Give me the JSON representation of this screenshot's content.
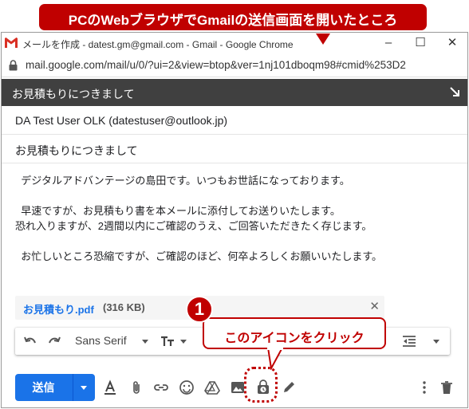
{
  "annotations": {
    "top_callout": "PCのWebブラウザでGmailの送信画面を開いたところ",
    "step_number": "1",
    "step_callout": "このアイコンをクリック"
  },
  "browser": {
    "window_title": "メールを作成 - datest.gm@gmail.com - Gmail - Google Chrome",
    "url": "mail.google.com/mail/u/0/?ui=2&view=btop&ver=1nj101dboqm98#cmid%253D2"
  },
  "compose": {
    "header_title": "お見積もりにつきまして",
    "to": "DA Test User OLK (datestuser@outlook.jp)",
    "subject": "お見積もりにつきまして",
    "body": [
      "  デジタルアドバンテージの島田です。いつもお世話になっております。",
      "",
      "  早速ですが、お見積もり書を本メールに添付してお送りいたします。",
      "恐れ入りますが、2週間以内にご確認のうえ、ご回答いただきたく存じます。",
      "",
      "  お忙しいところ恐縮ですが、ご確認のほど、何卒よろしくお願いいたします。"
    ],
    "attachment": {
      "name": "お見積もり.pdf",
      "size": "(316 KB)"
    },
    "toolbar": {
      "font": "Sans Serif"
    },
    "send_label": "送信"
  },
  "colors": {
    "accent": "#c00000",
    "send": "#1a73e8",
    "header": "#404040"
  }
}
